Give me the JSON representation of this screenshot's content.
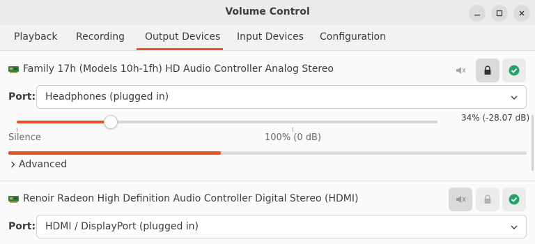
{
  "window": {
    "title": "Volume Control"
  },
  "tabs": [
    {
      "label": "Playback"
    },
    {
      "label": "Recording"
    },
    {
      "label": "Output Devices"
    },
    {
      "label": "Input Devices"
    },
    {
      "label": "Configuration"
    }
  ],
  "active_tab": "Output Devices",
  "devices": [
    {
      "name": "Family 17h (Models 10h-1fh) HD Audio Controller Analog Stereo",
      "port_label": "Port:",
      "port_value": "Headphones (plugged in)",
      "volume_readout": "34% (-28.07 dB)",
      "volume_fraction": 0.34,
      "level_fraction": 0.41,
      "scale_silence": "Silence",
      "scale_100": "100% (0 dB)",
      "advanced_label": "Advanced",
      "muted": false,
      "locked": true,
      "default": true
    },
    {
      "name": "Renoir Radeon High Definition Audio Controller Digital Stereo (HDMI)",
      "port_label": "Port:",
      "port_value": "HDMI / DisplayPort (plugged in)",
      "muted": true,
      "locked": false,
      "default": true
    }
  ],
  "colors": {
    "accent": "#e95420",
    "default_check": "#26a269"
  },
  "icons": {
    "minimize": "minimize-icon",
    "maximize": "maximize-icon",
    "close": "close-icon",
    "mute": "speaker-muted-icon",
    "lock": "lock-icon",
    "default": "check-circle-icon",
    "chevron": "chevron-down-icon",
    "advanced": "chevron-right-icon",
    "device": "sound-card-icon"
  }
}
